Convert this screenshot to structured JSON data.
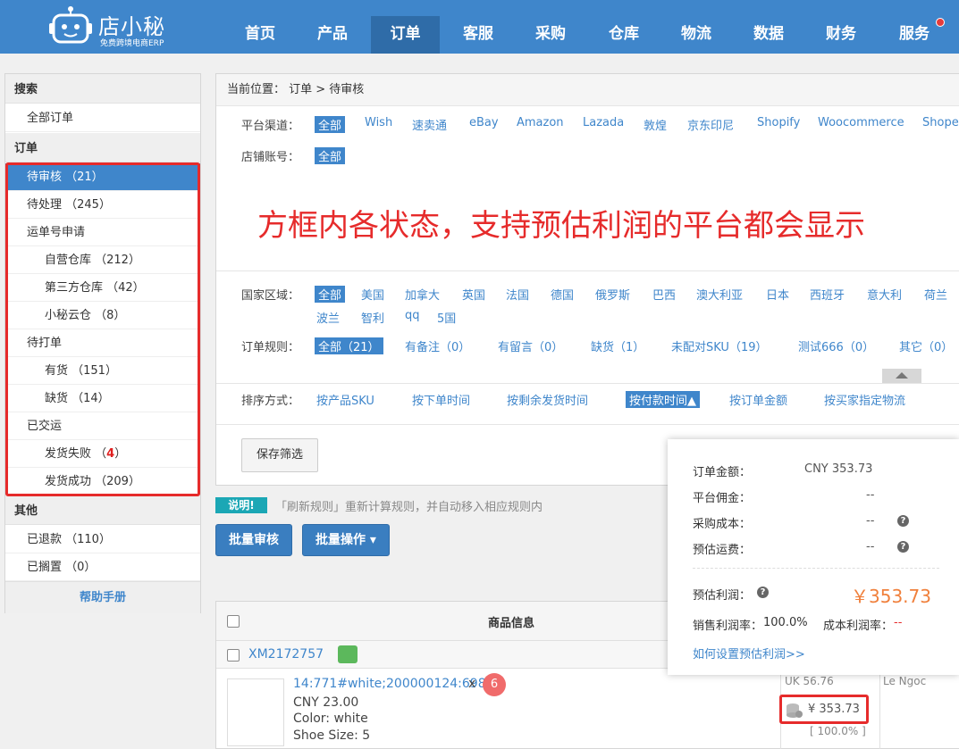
{
  "header": {
    "logo_name": "店小秘",
    "logo_sub": "免费跨境电商ERP",
    "nav": [
      "首页",
      "产品",
      "订单",
      "客服",
      "采购",
      "仓库",
      "物流",
      "数据",
      "财务",
      "服务"
    ],
    "active_nav": "订单"
  },
  "sidebar": {
    "search_head": "搜索",
    "all_orders": "全部订单",
    "order_head": "订单",
    "items": [
      {
        "label": "待审核 （21）"
      },
      {
        "label": "待处理 （245）"
      },
      {
        "label": "运单号申请"
      },
      {
        "label": "自营仓库 （212）"
      },
      {
        "label": "第三方仓库 （42）"
      },
      {
        "label": "小秘云仓 （8）"
      },
      {
        "label": "待打单"
      },
      {
        "label": "有货 （151）"
      },
      {
        "label": "缺货 （14）"
      },
      {
        "label": "已交运"
      },
      {
        "label_prefix": "发货失败 （",
        "count": "4",
        "label_suffix": "）"
      },
      {
        "label": "发货成功 （209）"
      }
    ],
    "other_head": "其他",
    "other_items": [
      {
        "label": "已退款 （110）"
      },
      {
        "label": "已搁置 （0）"
      }
    ],
    "help": "帮助手册"
  },
  "panel": {
    "breadcrumb": "当前位置： 订单 > 待审核",
    "platform_label": "平台渠道：",
    "platforms": [
      "全部",
      "Wish",
      "速卖通",
      "eBay",
      "Amazon",
      "Lazada",
      "敦煌",
      "京东印尼",
      "Shopify",
      "Woocommerce",
      "Shope"
    ],
    "shop_label": "店铺账号：",
    "shop_all": "全部",
    "annotation": "方框内各状态，支持预估利润的平台都会显示",
    "country_label": "国家区域：",
    "countries": [
      "全部",
      "美国",
      "加拿大",
      "英国",
      "法国",
      "德国",
      "俄罗斯",
      "巴西",
      "澳大利亚",
      "日本",
      "西班牙",
      "意大利",
      "荷兰",
      "波兰",
      "智利",
      "qq",
      "5国"
    ],
    "rule_label": "订单规则：",
    "rules": [
      "全部（21）",
      "有备注（0）",
      "有留言（0）",
      "缺货（1）",
      "未配对SKU（19）",
      "测试666（0）",
      "其它（0）"
    ],
    "sort_label": "排序方式：",
    "sorts": [
      "按产品SKU",
      "按下单时间",
      "按剩余发货时间",
      "按付款时间▲",
      "按订单金额",
      "按买家指定物流"
    ],
    "save_filter": "保存筛选"
  },
  "notice": {
    "badge": "说明!",
    "text": "「刷新规则」重新计算规则，并自动移入相应规则内"
  },
  "actions": {
    "batch_review": "批量审核",
    "batch_ops": "批量操作 ▾"
  },
  "table": {
    "header_product": "商品信息",
    "order_no": "XM2172757",
    "product_link": "14:771#white;200000124:698",
    "qty_x": "x",
    "qty": "6",
    "price": "CNY 23.00",
    "color": "Color:  white",
    "size": "Shoe Size:  5",
    "partial_col1": "UK  56.76",
    "partial_col2": "Le Ngoc",
    "profit_value": "¥  353.73",
    "profit_rate": "[ 100.0% ]"
  },
  "popup": {
    "order_amount_label": "订单金额：",
    "order_amount": "CNY 353.73",
    "commission_label": "平台佣金：",
    "commission": "--",
    "purchase_label": "采购成本：",
    "purchase": "--",
    "shipping_label": "预估运费：",
    "shipping": "--",
    "profit_label": "预估利润：",
    "profit": "￥353.73",
    "sales_margin_label": "销售利润率：",
    "sales_margin": "100.0%",
    "cost_margin_label": "成本利润率：",
    "cost_margin": "--",
    "howto": "如何设置预估利润>>"
  },
  "colors": {
    "primary": "#3f86cb",
    "annotation_red": "#e62b2b",
    "profit_orange": "#f0803c",
    "notice_teal": "#1ba7b5"
  }
}
